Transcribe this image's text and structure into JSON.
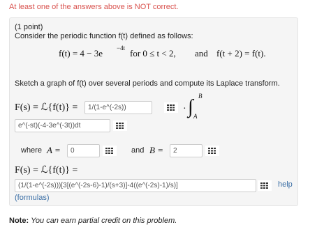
{
  "warning": "At least one of the answers above is NOT correct.",
  "problem": {
    "points": "(1 point)",
    "intro": "Consider the periodic function f(t) defined as follows:",
    "definition": {
      "lhs": "f(t) = 4 − 3e",
      "exponent": "−4t",
      "cond": "for 0 ≤ t < 2,",
      "and": "and",
      "periodic": "f(t + 2) = f(t)."
    },
    "task": "Sketch a graph of f(t) over several periods and compute its Laplace transform."
  },
  "answer1": {
    "label": "F(s) = ℒ{f(t)} =",
    "factor_value": "1/(1-e^(-2s))",
    "dot": "·",
    "integral_upper": "B",
    "integral_lower": "A",
    "integrand_value": "e^(-st)(-4-3e^(-3t))dt"
  },
  "limits": {
    "where": "where",
    "a_label": "A =",
    "a_value": "0",
    "and": "and",
    "b_label": "B =",
    "b_value": "2"
  },
  "answer2": {
    "label": "F(s) = ℒ{f(t)} =",
    "value": "(1/(1-e^(-2s)))[3[(e^(-2s-6)-1)/(s+3)]-4((e^(-2s)-1)/s)]",
    "help": "help",
    "formulas": "(formulas)"
  },
  "note": {
    "bold": "Note:",
    "text": "You can earn partial credit on this problem."
  },
  "icons": [
    "keypad-icon"
  ]
}
